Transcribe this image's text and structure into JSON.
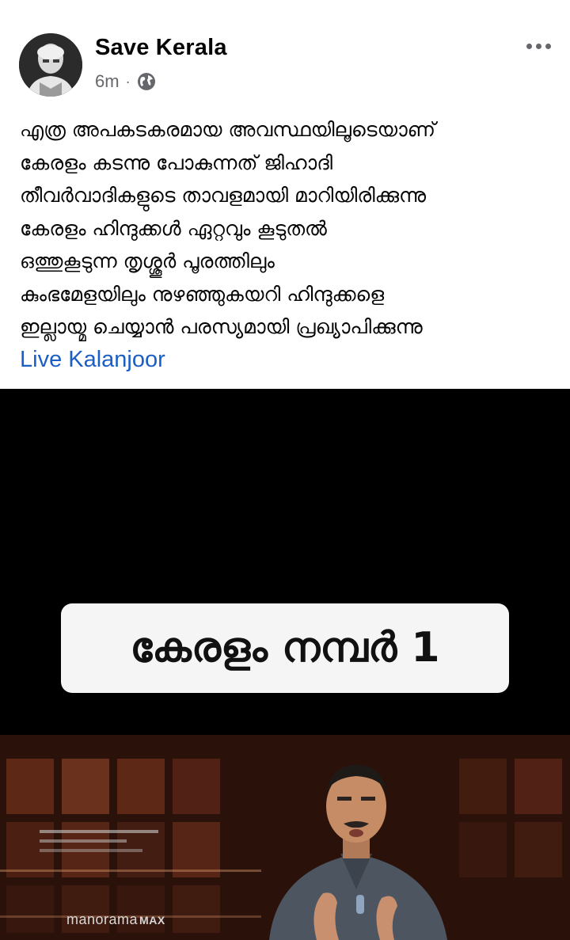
{
  "post": {
    "author": "Save Kerala",
    "time": "6m",
    "separator": "·",
    "privacy_icon": "globe-icon",
    "more_icon": "more-options-icon",
    "text_lines": [
      "എത്ര അപകടകരമായ അവസ്ഥയിലൂടെയാണ്",
      "കേരളം കടന്നു പോകുന്നത് ജിഹാദി",
      "തീവർവാദികളുടെ താവളമായി മാറിയിരിക്കുന്നു",
      "കേരളം ഹിന്ദുക്കൾ ഏറ്റവും കൂടുതൽ",
      "ഒത്തുകൂടുന്ന തൃശ്ശൂർ പൂരത്തിലും",
      "കുംഭമേളയിലും നുഴഞ്ഞുകയറി ഹിന്ദുക്കളെ",
      "ഇല്ലായ്മ ചെയ്യാൻ പരസ്യമായി പ്രഖ്യാപിക്കുന്നു"
    ],
    "link_text": "Live Kalanjoor"
  },
  "video": {
    "caption": "കേരളം നമ്പർ 1",
    "channel_logo": "manorama",
    "channel_logo_suffix": "MAX"
  },
  "colors": {
    "link": "#1b5fc4",
    "meta": "#65676b",
    "video_bg": "#000000",
    "caption_bg": "#f5f5f5"
  }
}
